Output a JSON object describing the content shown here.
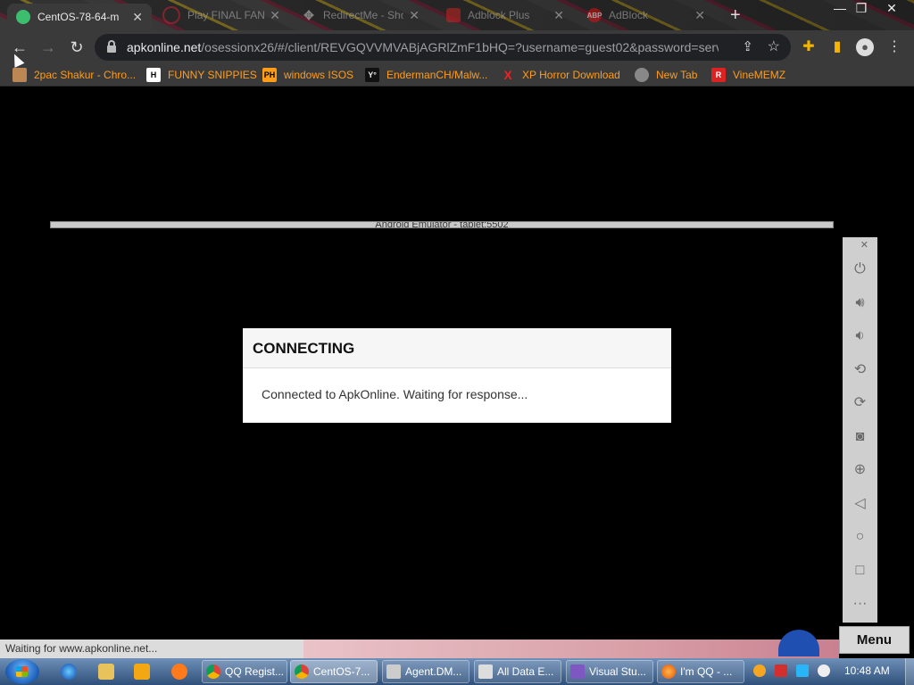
{
  "browser": {
    "tabs": [
      {
        "label": "CentOS-78-64-m",
        "active": true
      },
      {
        "label": "Play FINAL FAN",
        "active": false
      },
      {
        "label": "RedirectMe - Sho",
        "active": false
      },
      {
        "label": "Adblock Plus",
        "active": false
      },
      {
        "label": "AdBlock",
        "active": false
      }
    ],
    "address": {
      "host": "apkonline.net",
      "path": "/osessionx26/#/client/REVGQVVMVABjAGRlZmF1bHQ=?username=guest02&password=serv..."
    },
    "bookmarks": [
      "2pac Shakur - Chro...",
      "FUNNY SNIPPIES",
      "windows ISOS",
      "EndermanCH/Malw...",
      "XP Horror Download",
      "New Tab",
      "VineMEMZ"
    ]
  },
  "page": {
    "emulator_title": "Android Emulator - tablet:5502",
    "dialog": {
      "title": "CONNECTING",
      "message": "Connected to ApkOnline. Waiting for response..."
    },
    "menu_label": "Menu"
  },
  "status_text": "Waiting for www.apkonline.net...",
  "taskbar": {
    "tasks": [
      {
        "label": "QQ Regist...",
        "active": false
      },
      {
        "label": "CentOS-7...",
        "active": true
      },
      {
        "label": "Agent.DM...",
        "active": false
      },
      {
        "label": "All Data E...",
        "active": false
      },
      {
        "label": "Visual Stu...",
        "active": false
      },
      {
        "label": "I'm QQ - ...",
        "active": false
      }
    ],
    "clock": "10:48 AM"
  },
  "colors": {
    "bookmark_text": "#ff9c1a",
    "toolbar_bg": "#3a3a3a",
    "page_bg": "#000000",
    "taskbar_top": "#6e8fb7"
  }
}
